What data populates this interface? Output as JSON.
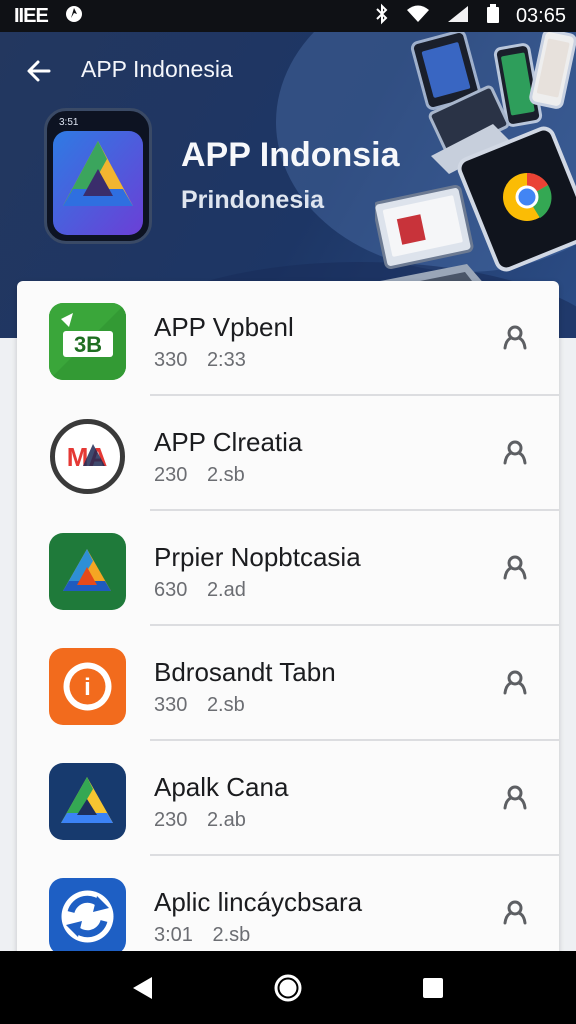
{
  "status_bar": {
    "brand": "IIEE",
    "time": "03:65"
  },
  "header": {
    "title": "APP Indonesia",
    "app_name": "APP Indonsia",
    "app_subtitle": "Prindonesia",
    "icon_phone_time": "3:51"
  },
  "apps": [
    {
      "title": "APP Vpbenl",
      "meta_a": "330",
      "meta_b": "2:33",
      "icon": "green-3b-icon",
      "icon_text": "3B",
      "color": "#3aa63a"
    },
    {
      "title": "APP Clreatia",
      "meta_a": "230",
      "meta_b": "2.sb",
      "icon": "ma-logo-icon",
      "icon_text": "MA",
      "color": "#e53935"
    },
    {
      "title": "Prpier Nopbtcasia",
      "meta_a": "630",
      "meta_b": "2.ad",
      "icon": "drive-triangle-icon",
      "icon_text": "",
      "color": "#1f7a3a"
    },
    {
      "title": "Bdrosandt Tabn",
      "meta_a": "330",
      "meta_b": "2.sb",
      "icon": "info-icon",
      "icon_text": "i",
      "color": "#f26b1d"
    },
    {
      "title": "Apalk Cana",
      "meta_a": "230",
      "meta_b": "2.ab",
      "icon": "drive-triangle-icon",
      "icon_text": "",
      "color": "#173a6e"
    },
    {
      "title": "Aplic lincáycbsara",
      "meta_a": "3:01",
      "meta_b": "2.sb",
      "icon": "refresh-arrows-icon",
      "icon_text": "",
      "color": "#1e5fc4"
    }
  ],
  "colors": {
    "header_bg": "#1d3665",
    "card_bg": "#fbfbfb",
    "nav_bg": "#000000"
  }
}
